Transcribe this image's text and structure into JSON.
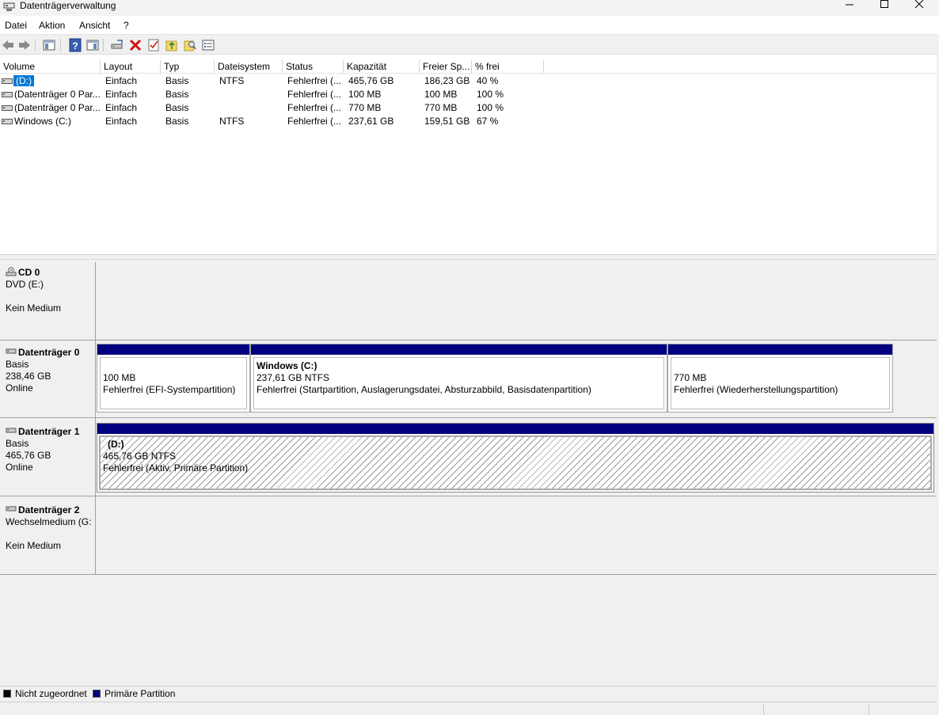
{
  "window": {
    "title": "Datenträgerverwaltung"
  },
  "menu": [
    "Datei",
    "Aktion",
    "Ansicht",
    "?"
  ],
  "toolbar": {
    "icons": [
      "back-icon",
      "forward-icon",
      "show-hide-console-tree-icon",
      "help-icon",
      "show-hide-action-pane-icon",
      "connect-disk-icon",
      "delete-icon",
      "properties-icon",
      "export-icon",
      "find-icon",
      "settings-icon"
    ]
  },
  "volume_list": {
    "columns": [
      "Volume",
      "Layout",
      "Typ",
      "Dateisystem",
      "Status",
      "Kapazität",
      "Freier Sp...",
      "% frei"
    ],
    "rows": [
      {
        "volume": "(D:)",
        "layout": "Einfach",
        "typ": "Basis",
        "fs": "NTFS",
        "status": "Fehlerfrei (...",
        "capacity": "465,76 GB",
        "free": "186,23 GB",
        "pct": "40 %",
        "selected": true
      },
      {
        "volume": "(Datenträger 0 Par...",
        "layout": "Einfach",
        "typ": "Basis",
        "fs": "",
        "status": "Fehlerfrei (...",
        "capacity": "100 MB",
        "free": "100 MB",
        "pct": "100 %",
        "selected": false
      },
      {
        "volume": "(Datenträger 0 Par...",
        "layout": "Einfach",
        "typ": "Basis",
        "fs": "",
        "status": "Fehlerfrei (...",
        "capacity": "770 MB",
        "free": "770 MB",
        "pct": "100 %",
        "selected": false
      },
      {
        "volume": "Windows (C:)",
        "layout": "Einfach",
        "typ": "Basis",
        "fs": "NTFS",
        "status": "Fehlerfrei (...",
        "capacity": "237,61 GB",
        "free": "159,51 GB",
        "pct": "67 %",
        "selected": false
      }
    ]
  },
  "disks": {
    "cd0": {
      "name": "CD 0",
      "line1": "DVD (E:)",
      "line2": "",
      "line3": "Kein Medium"
    },
    "disk0": {
      "name": "Datenträger 0",
      "line1": "Basis",
      "line2": "238,46 GB",
      "line3": "Online",
      "partitions": [
        {
          "title": "",
          "size": "100 MB",
          "status": "Fehlerfrei (EFI-Systempartition)"
        },
        {
          "title": "Windows  (C:)",
          "size": "237,61 GB NTFS",
          "status": "Fehlerfrei (Startpartition, Auslagerungsdatei, Absturzabbild, Basisdatenpartition)"
        },
        {
          "title": "",
          "size": "770 MB",
          "status": "Fehlerfrei (Wiederherstellungspartition)"
        }
      ]
    },
    "disk1": {
      "name": "Datenträger 1",
      "line1": "Basis",
      "line2": "465,76 GB",
      "line3": "Online",
      "partitions": [
        {
          "title": "(D:)",
          "size": "465,76 GB NTFS",
          "status": "Fehlerfrei (Aktiv, Primäre Partition)"
        }
      ]
    },
    "disk2": {
      "name": "Datenträger 2",
      "line1": "Wechselmedium (G:",
      "line2": "",
      "line3": "Kein Medium"
    }
  },
  "legend": {
    "unallocated": "Nicht zugeordnet",
    "primary": "Primäre Partition",
    "unallocated_color": "#000000",
    "primary_color": "#000080"
  }
}
